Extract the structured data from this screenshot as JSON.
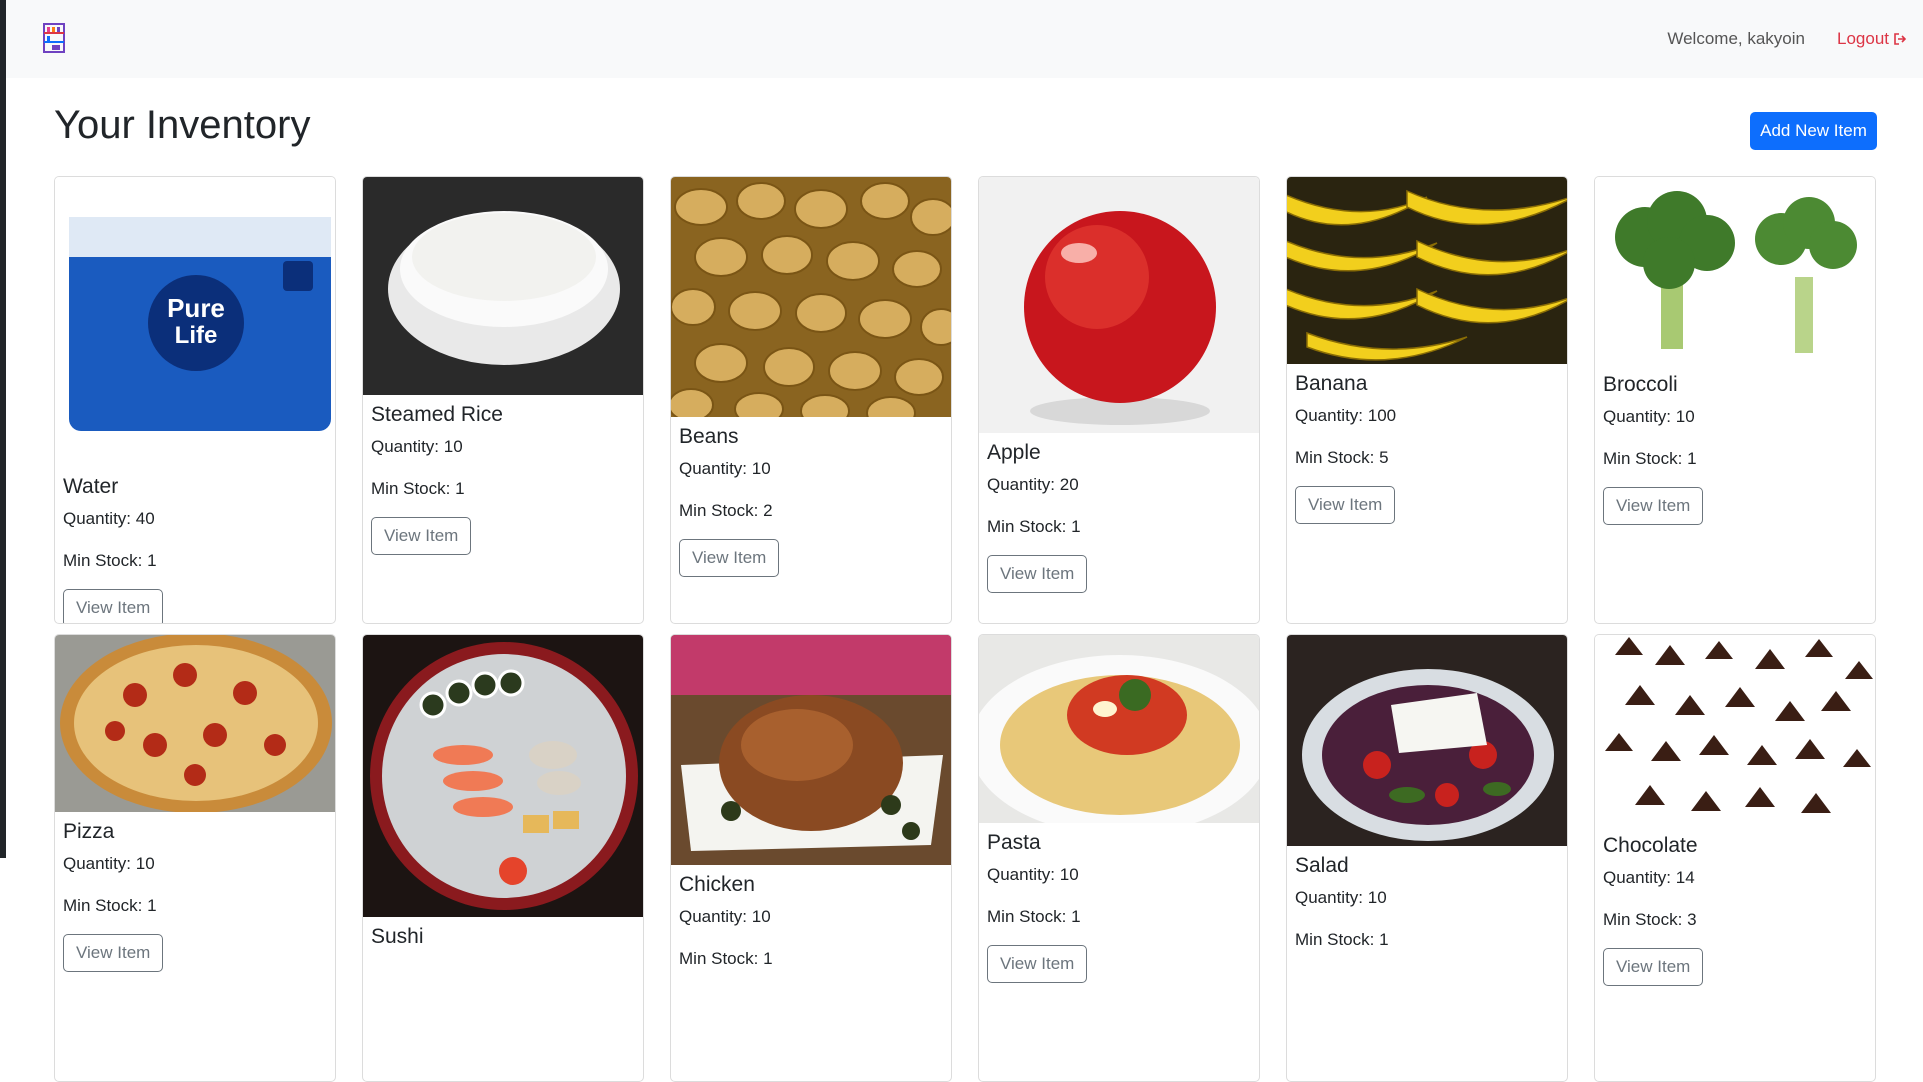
{
  "navbar": {
    "welcome": "Welcome, kakyoin",
    "logout": "Logout",
    "logo_icon": "inventory-shelf-logo-icon",
    "logout_icon": "sign-out-icon"
  },
  "page": {
    "title": "Your Inventory",
    "add_button": "Add New Item"
  },
  "labels": {
    "view_button": "View Item"
  },
  "items": [
    {
      "name": "Water",
      "quantity": "Quantity: 40",
      "min_stock": "Min Stock: 1",
      "image": "water-bottle-pack"
    },
    {
      "name": "Steamed Rice",
      "quantity": "Quantity: 10",
      "min_stock": "Min Stock: 1",
      "image": "rice-bowl"
    },
    {
      "name": "Beans",
      "quantity": "Quantity: 10",
      "min_stock": "Min Stock: 2",
      "image": "beans"
    },
    {
      "name": "Apple",
      "quantity": "Quantity: 20",
      "min_stock": "Min Stock: 1",
      "image": "red-apple"
    },
    {
      "name": "Banana",
      "quantity": "Quantity: 100",
      "min_stock": "Min Stock: 5",
      "image": "bananas"
    },
    {
      "name": "Broccoli",
      "quantity": "Quantity: 10",
      "min_stock": "Min Stock: 1",
      "image": "broccoli"
    },
    {
      "name": "Pizza",
      "quantity": "Quantity: 10",
      "min_stock": "Min Stock: 1",
      "image": "pepperoni-pizza"
    },
    {
      "name": "Sushi",
      "quantity": "",
      "min_stock": "",
      "image": "sushi-platter"
    },
    {
      "name": "Chicken",
      "quantity": "Quantity: 10",
      "min_stock": "Min Stock: 1",
      "image": "roast-chicken"
    },
    {
      "name": "Pasta",
      "quantity": "Quantity: 10",
      "min_stock": "Min Stock: 1",
      "image": "spaghetti"
    },
    {
      "name": "Salad",
      "quantity": "Quantity: 10",
      "min_stock": "Min Stock: 1",
      "image": "greek-salad"
    },
    {
      "name": "Chocolate",
      "quantity": "Quantity: 14",
      "min_stock": "Min Stock: 3",
      "image": "chocolate-chips"
    }
  ],
  "colors": {
    "primary": "#0d6efd",
    "danger": "#dc3545",
    "navbar_bg": "#f8f9fa",
    "card_border": "#dcdcdc"
  }
}
